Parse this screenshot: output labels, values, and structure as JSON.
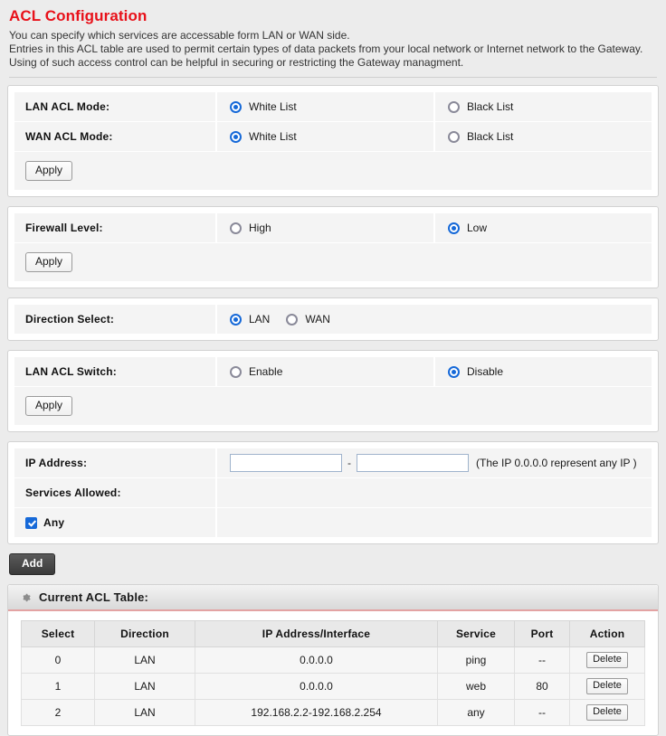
{
  "header": {
    "title": "ACL Configuration",
    "intro_lines": [
      "You can specify which services are accessable form LAN or WAN side.",
      "Entries in this ACL table are used to permit certain types of data packets from your local network or Internet network to the Gateway.",
      "Using of such access control can be helpful in securing or restricting the Gateway managment."
    ]
  },
  "acl_mode_panel": {
    "lan_label": "LAN ACL Mode:",
    "wan_label": "WAN ACL Mode:",
    "lan_white_label": "White List",
    "lan_black_label": "Black List",
    "wan_white_label": "White List",
    "wan_black_label": "Black List",
    "lan_selected": "White List",
    "wan_selected": "White List",
    "apply_label": "Apply"
  },
  "firewall_panel": {
    "label": "Firewall Level:",
    "high_label": "High",
    "low_label": "Low",
    "selected": "Low",
    "apply_label": "Apply"
  },
  "direction_panel": {
    "label": "Direction Select:",
    "lan_label": "LAN",
    "wan_label": "WAN",
    "selected": "LAN"
  },
  "lan_switch_panel": {
    "label": "LAN ACL Switch:",
    "enable_label": "Enable",
    "disable_label": "Disable",
    "selected": "Disable",
    "apply_label": "Apply"
  },
  "ip_panel": {
    "ip_label": "IP Address:",
    "ip_start_value": "",
    "ip_end_value": "",
    "separator": "-",
    "hint": "(The IP 0.0.0.0 represent any IP )",
    "services_label": "Services Allowed:",
    "any_label": "Any",
    "any_checked": true
  },
  "add_button_label": "Add",
  "table_section": {
    "title": "Current ACL Table:",
    "icon": "gear-icon",
    "columns": [
      "Select",
      "Direction",
      "IP Address/Interface",
      "Service",
      "Port",
      "Action"
    ],
    "rows": [
      {
        "select": "0",
        "direction": "LAN",
        "ip": "0.0.0.0",
        "service": "ping",
        "port": "--",
        "action": "Delete"
      },
      {
        "select": "1",
        "direction": "LAN",
        "ip": "0.0.0.0",
        "service": "web",
        "port": "80",
        "action": "Delete"
      },
      {
        "select": "2",
        "direction": "LAN",
        "ip": "192.168.2.2-192.168.2.254",
        "service": "any",
        "port": "--",
        "action": "Delete"
      }
    ]
  },
  "colors": {
    "title_red": "#e8111a",
    "accent_blue": "#1669d8",
    "page_bg": "#ececec",
    "panel_bg": "#ffffff",
    "row_bg": "#f4f4f4"
  }
}
